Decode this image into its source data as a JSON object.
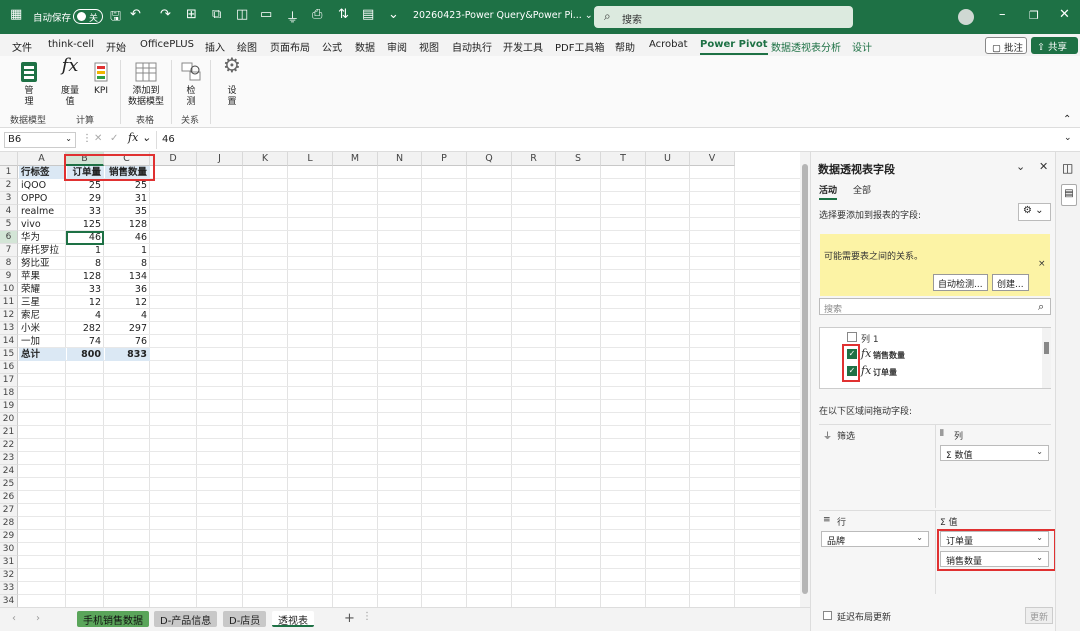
{
  "titlebar": {
    "autosave_label": "自动保存",
    "autosave_state": "关",
    "filename": "20260423-Power Query&Power Pi... ⌄",
    "search_placeholder": "搜索"
  },
  "menu": [
    "文件",
    "think-cell",
    "开始",
    "OfficePLUS",
    "插入",
    "绘图",
    "页面布局",
    "公式",
    "数据",
    "审阅",
    "视图",
    "自动执行",
    "开发工具",
    "PDF工具箱",
    "帮助",
    "Acrobat",
    "Power Pivot",
    "数据透视表分析",
    "设计"
  ],
  "menu_active": "Power Pivot",
  "comments_label": "批注",
  "share_label": "共享",
  "ribbon": {
    "manage": "管\n理",
    "measures": "度量\n值",
    "kpi": "KPI",
    "add_to_model": "添加到\n数据模型",
    "detect": "检\n测",
    "settings": "设\n置",
    "groups": [
      "数据模型",
      "计算",
      "表格",
      "关系"
    ]
  },
  "formula": {
    "namebox": "B6",
    "value": "46"
  },
  "grid": {
    "columns": [
      "A",
      "B",
      "C",
      "D",
      "J",
      "K",
      "L",
      "M",
      "N",
      "P",
      "Q",
      "R",
      "S",
      "T",
      "U",
      "V"
    ],
    "headers": [
      "行标签",
      "订单量",
      "销售数量"
    ],
    "rows": [
      [
        "iQOO",
        "25",
        "25"
      ],
      [
        "OPPO",
        "29",
        "31"
      ],
      [
        "realme",
        "33",
        "35"
      ],
      [
        "vivo",
        "125",
        "128"
      ],
      [
        "华为",
        "46",
        "46"
      ],
      [
        "摩托罗拉",
        "1",
        "1"
      ],
      [
        "努比亚",
        "8",
        "8"
      ],
      [
        "苹果",
        "128",
        "134"
      ],
      [
        "荣耀",
        "33",
        "36"
      ],
      [
        "三星",
        "12",
        "12"
      ],
      [
        "索尼",
        "4",
        "4"
      ],
      [
        "小米",
        "282",
        "297"
      ],
      [
        "一加",
        "74",
        "76"
      ]
    ],
    "total": [
      "总计",
      "800",
      "833"
    ],
    "row_count": 34
  },
  "sheets": [
    "手机销售数据",
    "D-产品信息",
    "D-店员",
    "透视表"
  ],
  "active_sheet": "透视表",
  "pane": {
    "title": "数据透视表字段",
    "tab_active": "活动",
    "tab_all": "全部",
    "choose_label": "选择要添加到报表的字段:",
    "notice": "可能需要表之间的关系。",
    "auto_detect": "自动检测...",
    "create": "创建...",
    "search_placeholder": "搜索",
    "fields": [
      {
        "name": "列 1",
        "checked": false,
        "fx": false
      },
      {
        "name": "销售数量",
        "checked": true,
        "fx": true
      },
      {
        "name": "订单量",
        "checked": true,
        "fx": true
      }
    ],
    "drag_label": "在以下区域间拖动字段:",
    "filter_label": "筛选",
    "columns_label": "列",
    "columns_value": "Σ 数值",
    "rows_label": "行",
    "rows_value": "品牌",
    "values_label": "Σ 值",
    "values": [
      "订单量",
      "销售数量"
    ],
    "defer_label": "延迟布局更新",
    "update_label": "更新"
  }
}
